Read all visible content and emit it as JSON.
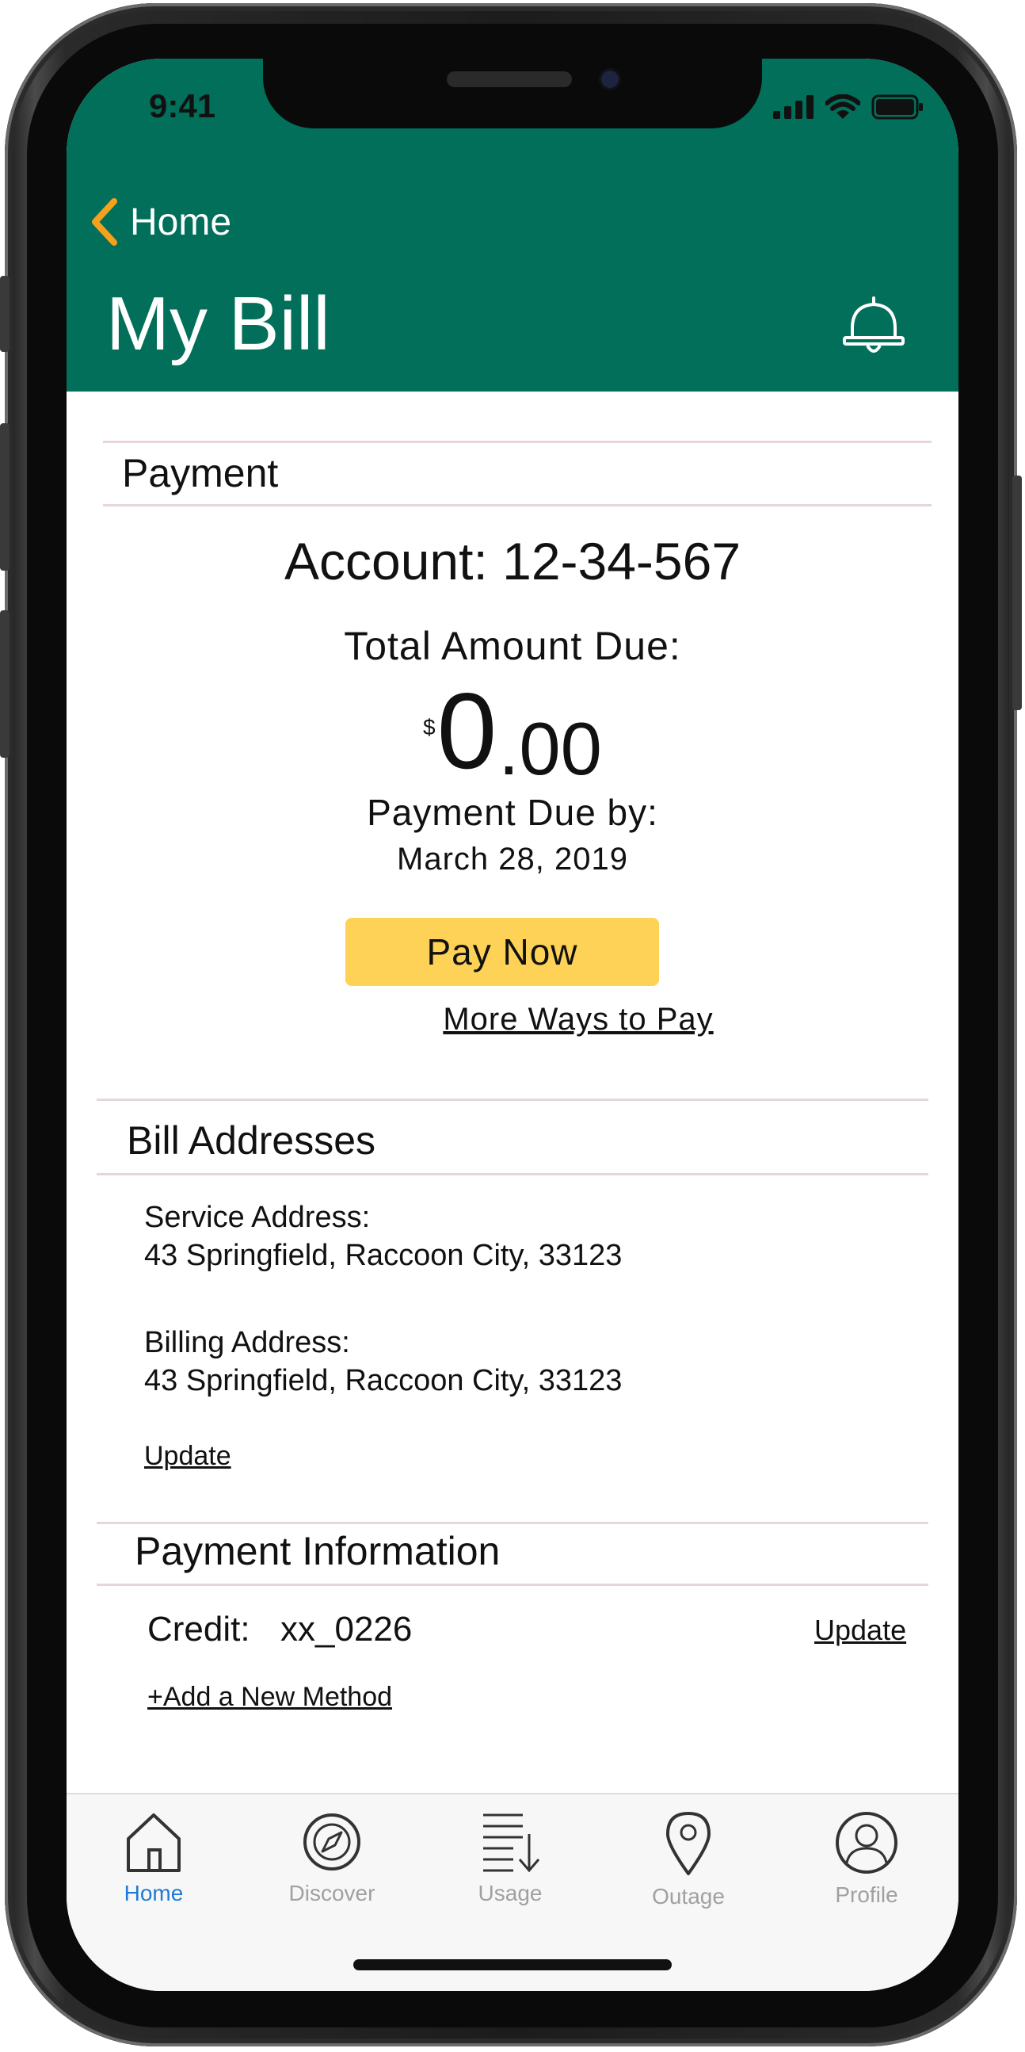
{
  "status_bar": {
    "time": "9:41"
  },
  "header": {
    "back_label": "Home",
    "title": "My Bill",
    "accent": "#016f5a"
  },
  "payment": {
    "section_title": "Payment",
    "account": "Account: 12-34-567",
    "total_label": "Total Amount Due:",
    "currency": "$",
    "amount_whole": "0",
    "amount_frac": ".00",
    "due_label": "Payment Due by:",
    "due_date": "March  28, 2019",
    "pay_button": "Pay Now",
    "pay_button_color": "#fdd257",
    "more_ways": "More Ways to Pay"
  },
  "addresses": {
    "section_title": "Bill Addresses",
    "service_label": "Service Address:",
    "service_value": "43 Springfield, Raccoon City, 33123",
    "billing_label": "Billing Address:",
    "billing_value": "43 Springfield, Raccoon City, 33123",
    "update": "Update"
  },
  "payment_info": {
    "section_title": "Payment Information",
    "method_label": "Credit:",
    "method_value": "xx_0226",
    "update": "Update",
    "add_method": "+Add a New Method"
  },
  "tabs": [
    {
      "label": "Home",
      "icon": "house-icon",
      "active": true
    },
    {
      "label": "Discover",
      "icon": "compass-icon",
      "active": false
    },
    {
      "label": "Usage",
      "icon": "usage-list-icon",
      "active": false
    },
    {
      "label": "Outage",
      "icon": "map-pin-icon",
      "active": false
    },
    {
      "label": "Profile",
      "icon": "person-icon",
      "active": false
    }
  ],
  "colors": {
    "tab_active": "#1e7ad6",
    "tab_inactive": "#a0a0a0"
  }
}
